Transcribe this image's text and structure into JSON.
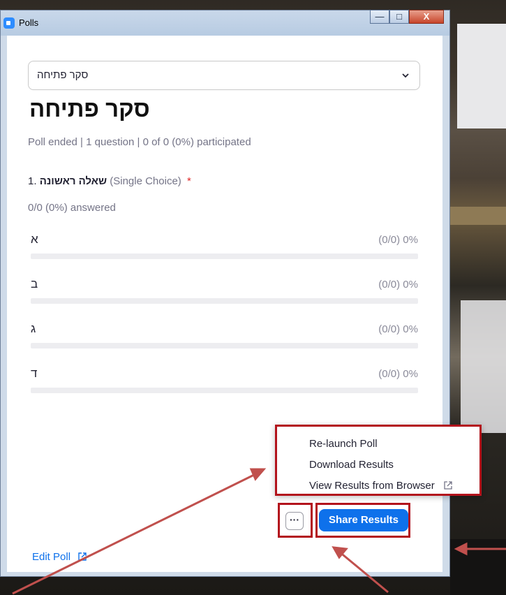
{
  "window": {
    "title": "Polls",
    "minimize_glyph": "—",
    "maximize_glyph": "□",
    "close_glyph": "X"
  },
  "poll": {
    "selector_value": "סקר פתיחה",
    "title": "סקר פתיחה",
    "meta": "Poll ended  |  1 question  |  0 of 0 (0%) participated",
    "question": {
      "number": "1.",
      "text": "שאלה ראשונה",
      "type": "(Single Choice)",
      "required_mark": "*",
      "answered": "0/0 (0%) answered"
    },
    "options": [
      {
        "label": "א",
        "result": "(0/0) 0%",
        "fraction": 0
      },
      {
        "label": "ב",
        "result": "(0/0) 0%",
        "fraction": 0
      },
      {
        "label": "ג",
        "result": "(0/0) 0%",
        "fraction": 0
      },
      {
        "label": "ד",
        "result": "(0/0) 0%",
        "fraction": 0
      }
    ]
  },
  "menu": {
    "relaunch": "Re-launch Poll",
    "download": "Download Results",
    "view_browser": "View Results from Browser"
  },
  "footer": {
    "edit_poll": "Edit Poll",
    "more_glyph": "···",
    "share_results": "Share Results"
  },
  "colors": {
    "accent": "#0e71eb",
    "highlight": "#b3131c",
    "annotation_arrow": "#c0504d"
  }
}
